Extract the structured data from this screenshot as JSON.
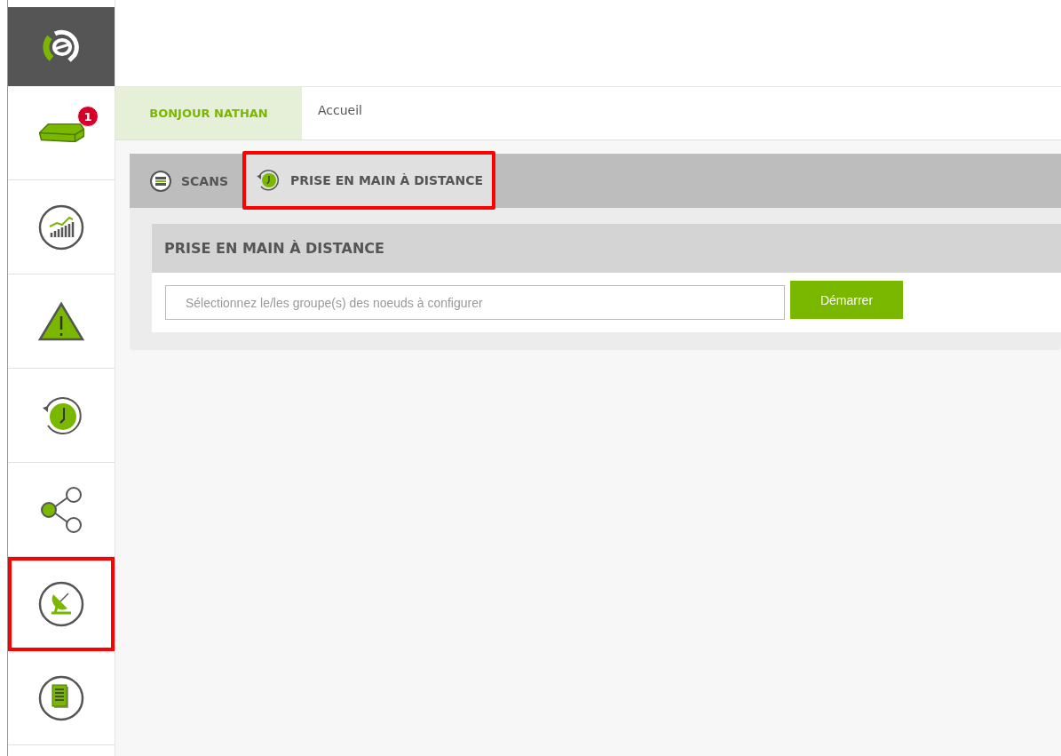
{
  "sidebar": {
    "items": [
      {
        "kind": "device",
        "badge": "1",
        "highlighted": false
      },
      {
        "kind": "chart",
        "highlighted": false
      },
      {
        "kind": "warning",
        "highlighted": false
      },
      {
        "kind": "restore",
        "highlighted": false
      },
      {
        "kind": "share",
        "highlighted": false
      },
      {
        "kind": "satellite",
        "highlighted": true
      },
      {
        "kind": "document",
        "highlighted": false
      }
    ]
  },
  "breadcrumb": {
    "greeting": "BONJOUR NATHAN",
    "page": "Accueil"
  },
  "tabs": [
    {
      "label": "SCANS",
      "kind": "scans",
      "selected": false,
      "highlighted": false
    },
    {
      "label": "PRISE EN MAIN À DISTANCE",
      "kind": "restore",
      "selected": true,
      "highlighted": true
    }
  ],
  "panel": {
    "title": "PRISE EN MAIN À DISTANCE",
    "field": {
      "placeholder": "Sélectionnez le/les groupe(s) des noeuds à configurer"
    },
    "button": "Démarrer"
  }
}
